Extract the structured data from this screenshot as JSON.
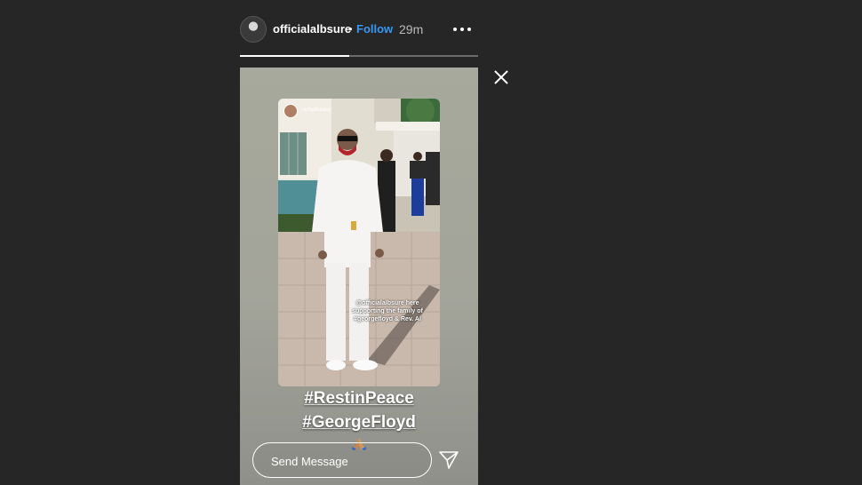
{
  "header": {
    "username": "officialalbsure",
    "separator": "•",
    "follow_label": "Follow",
    "time": "29m",
    "more_icon": "more-horizontal-icon"
  },
  "story": {
    "progress_fraction": 0.46,
    "repost": {
      "username": "rachellsnard"
    },
    "caption": "@officialalbsure here supporting the family of #georgefloyd & Rev. Al",
    "hashtags": [
      "#RestinPeace",
      "#GeorgeFloyd"
    ],
    "emoji": "folded-hands"
  },
  "composer": {
    "placeholder": "Send Message",
    "value": ""
  },
  "icons": {
    "close": "close-icon",
    "send": "send-icon"
  },
  "colors": {
    "background": "#262626",
    "follow": "#3897f0",
    "text": "#ffffff"
  }
}
